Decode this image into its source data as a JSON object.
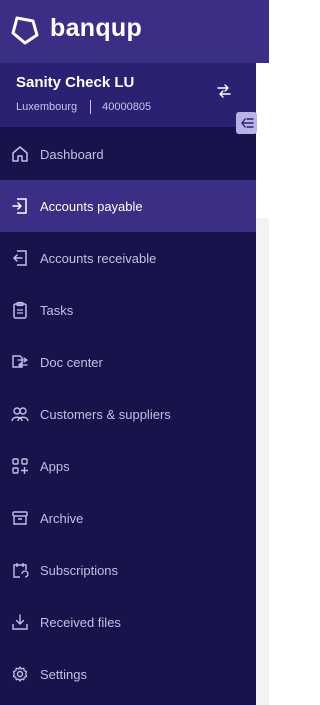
{
  "brand": {
    "name": "banqup"
  },
  "company": {
    "name": "Sanity Check LU",
    "country": "Luxembourg",
    "id": "40000805"
  },
  "nav": [
    {
      "label": "Dashboard",
      "icon": "home-icon"
    },
    {
      "label": "Accounts payable",
      "icon": "inbox-in-icon",
      "active": true
    },
    {
      "label": "Accounts receivable",
      "icon": "inbox-out-icon"
    },
    {
      "label": "Tasks",
      "icon": "clipboard-icon"
    },
    {
      "label": "Doc center",
      "icon": "doc-transfer-icon"
    },
    {
      "label": "Customers & suppliers",
      "icon": "people-icon"
    },
    {
      "label": "Apps",
      "icon": "apps-icon"
    },
    {
      "label": "Archive",
      "icon": "archive-icon"
    },
    {
      "label": "Subscriptions",
      "icon": "calendar-sync-icon"
    },
    {
      "label": "Received files",
      "icon": "download-tray-icon"
    },
    {
      "label": "Settings",
      "icon": "gear-icon"
    }
  ],
  "colors": {
    "sidebar": "#18134a",
    "brand_bar": "#3a2f85",
    "active": "#3a2f85",
    "company": "#2a2172"
  }
}
